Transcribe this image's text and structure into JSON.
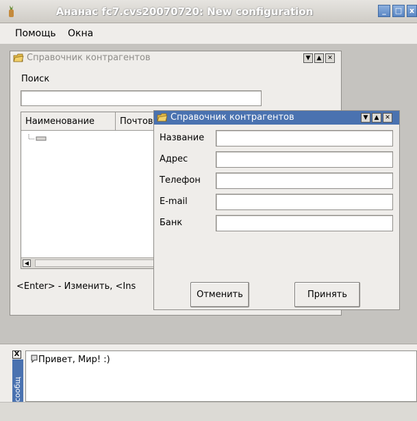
{
  "window": {
    "title": "Ананас fc7.cvs20070720: New configuration",
    "buttons": [
      "_",
      "□",
      "x"
    ]
  },
  "menu": {
    "items": [
      "Помощь",
      "Окна"
    ]
  },
  "back_window": {
    "title": "Справочник контрагентов",
    "search_label": "Поиск",
    "search_value": "",
    "columns": [
      "Наименование",
      "Почтов"
    ],
    "hint": "<Enter> - Изменить, <Ins"
  },
  "dialog": {
    "title": "Справочник контрагентов",
    "fields": [
      {
        "label": "Название",
        "value": ""
      },
      {
        "label": "Адрес",
        "value": ""
      },
      {
        "label": "Телефон",
        "value": ""
      },
      {
        "label": "E-mail",
        "value": ""
      },
      {
        "label": "Банк",
        "value": ""
      }
    ],
    "cancel_label": "Отменить",
    "accept_label": "Принять"
  },
  "messages": {
    "tab_label": "сообщ",
    "close": "X",
    "text": "Привет, Мир! :)"
  },
  "colors": {
    "accent": "#4a72b0",
    "title_text": "#ffffff"
  }
}
